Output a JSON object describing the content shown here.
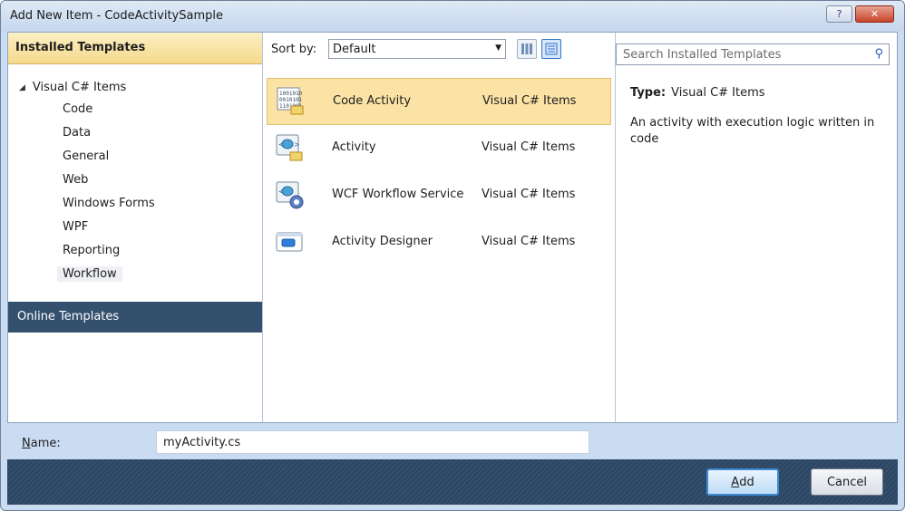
{
  "window": {
    "title": "Add New Item - CodeActivitySample",
    "help_glyph": "?",
    "close_glyph": "✕"
  },
  "left": {
    "installed_header": "Installed Templates",
    "tree_root": "Visual C# Items",
    "tree_items": [
      "Code",
      "Data",
      "General",
      "Web",
      "Windows Forms",
      "WPF",
      "Reporting",
      "Workflow"
    ],
    "selected_item": "Workflow",
    "online_header": "Online Templates"
  },
  "middle": {
    "sort_label": "Sort by:",
    "sort_value": "Default",
    "templates": [
      {
        "name": "Code Activity",
        "category": "Visual C# Items",
        "icon": "code-activity-icon",
        "selected": true
      },
      {
        "name": "Activity",
        "category": "Visual C# Items",
        "icon": "activity-icon",
        "selected": false
      },
      {
        "name": "WCF Workflow Service",
        "category": "Visual C# Items",
        "icon": "wcf-workflow-service-icon",
        "selected": false
      },
      {
        "name": "Activity Designer",
        "category": "Visual C# Items",
        "icon": "activity-designer-icon",
        "selected": false
      }
    ]
  },
  "right": {
    "search_placeholder": "Search Installed Templates",
    "type_label": "Type:",
    "type_value": "Visual C# Items",
    "description": "An activity with execution logic written in code"
  },
  "namebar": {
    "label_underlined": "N",
    "label_rest": "ame:",
    "value": "myActivity.cs"
  },
  "footer": {
    "add_underlined": "A",
    "add_rest": "dd",
    "cancel_label": "Cancel"
  },
  "colors": {
    "selection": "#fbe3a5",
    "online_header": "#34506f",
    "installed_header": "#f5d98c"
  }
}
